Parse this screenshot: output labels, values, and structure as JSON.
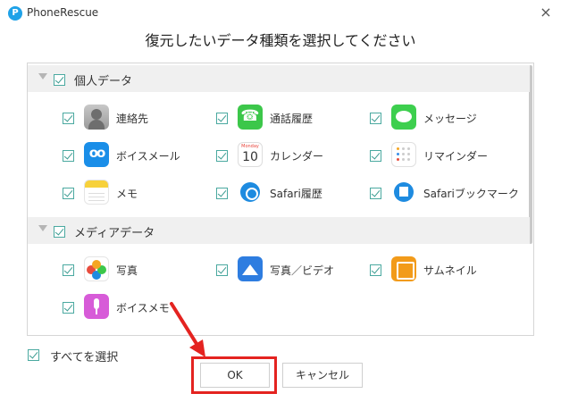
{
  "window": {
    "title": "PhoneRescue",
    "logo_letter": "P",
    "close_label": "×"
  },
  "dialog": {
    "heading": "復元したいデータ種類を選択してください"
  },
  "sections": [
    {
      "label": "個人データ",
      "items": [
        {
          "label": "連絡先",
          "icon": "contacts-icon"
        },
        {
          "label": "通話履歴",
          "icon": "phone-icon"
        },
        {
          "label": "メッセージ",
          "icon": "messages-icon"
        },
        {
          "label": "ボイスメール",
          "icon": "voicemail-icon"
        },
        {
          "label": "カレンダー",
          "icon": "calendar-icon"
        },
        {
          "label": "リマインダー",
          "icon": "reminders-icon"
        },
        {
          "label": "メモ",
          "icon": "notes-icon"
        },
        {
          "label": "Safari履歴",
          "icon": "safari-history-icon"
        },
        {
          "label": "Safariブックマーク",
          "icon": "safari-bookmark-icon"
        }
      ]
    },
    {
      "label": "メディアデータ",
      "items": [
        {
          "label": "写真",
          "icon": "photos-icon"
        },
        {
          "label": "写真／ビデオ",
          "icon": "photo-video-icon"
        },
        {
          "label": "サムネイル",
          "icon": "thumbnail-icon"
        },
        {
          "label": "ボイスメモ",
          "icon": "voice-memo-icon"
        }
      ]
    }
  ],
  "footer": {
    "select_all_label": "すべてを選択",
    "ok_label": "OK",
    "cancel_label": "キャンセル"
  },
  "colors": {
    "annotation_red": "#e42320",
    "check_teal": "#3b9b91",
    "section_bg": "#f0f0f0"
  }
}
